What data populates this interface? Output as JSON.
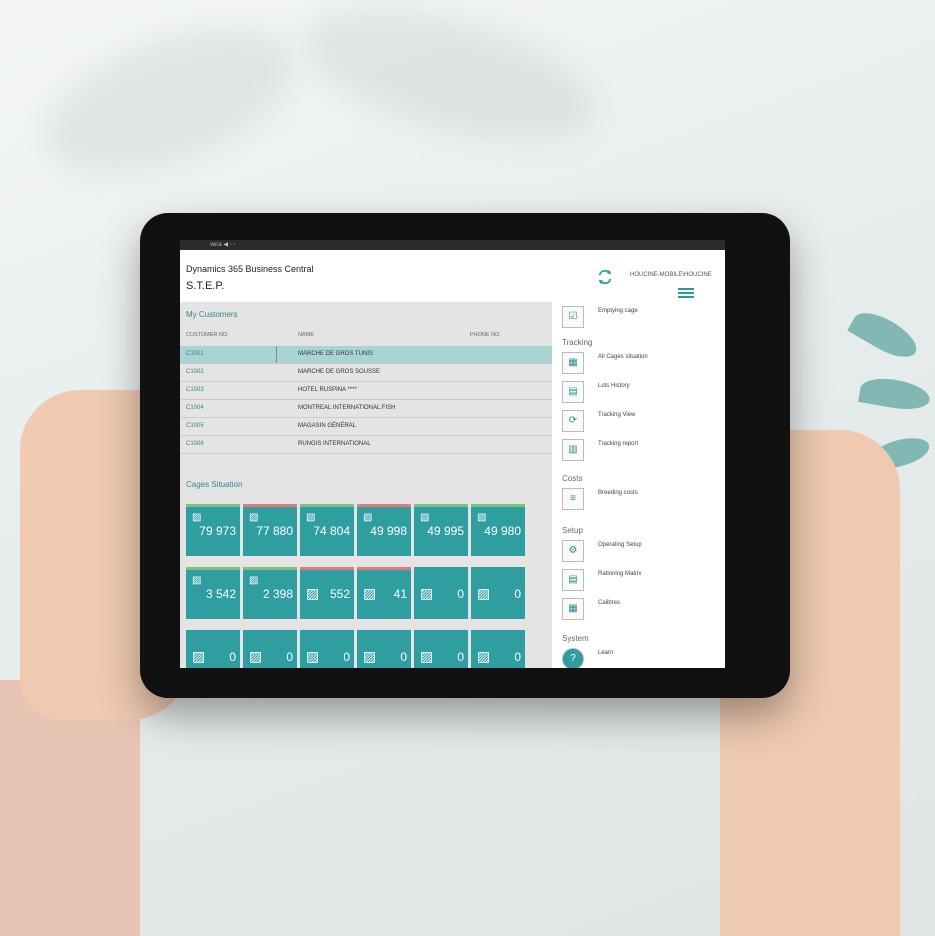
{
  "app": {
    "title": "Dynamics 365 Business Central",
    "company": "S.T.E.P.",
    "user": "HOUCINE-MOBILE\\HOUCINE"
  },
  "customers": {
    "title": "My Customers",
    "columns": [
      "CUSTOMER NO.",
      "NAME",
      "PHONE NO."
    ],
    "rows": [
      {
        "no": "C1001",
        "name": "MARCHE DE GROS TUNIS"
      },
      {
        "no": "C1002",
        "name": "MARCHE DE GROS SOUSSE"
      },
      {
        "no": "C1003",
        "name": "HOTEL RUSPINA ****"
      },
      {
        "no": "C1004",
        "name": "MONTREAL INTERNATIONAL FISH"
      },
      {
        "no": "C1005",
        "name": "MAGASIN GÉNÉRAL"
      },
      {
        "no": "C1006",
        "name": "RUNGIS INTERNATIONAL"
      }
    ]
  },
  "cages": {
    "title": "Cages Situation",
    "row1": [
      "79 973",
      "77 880",
      "74 804",
      "49 998",
      "49 995",
      "49 980"
    ],
    "row2": [
      "3 542",
      "2 398",
      "552",
      "41",
      "0",
      "0"
    ],
    "row3": [
      "0",
      "0",
      "0",
      "0",
      "0",
      "0"
    ],
    "bar_colors": {
      "red": "#e07b7b",
      "green": "#7bc47b"
    }
  },
  "sidebar": {
    "top_item": "Emptying cage",
    "groups": [
      {
        "title": "Tracking",
        "items": [
          "All Cages situation",
          "Lots History",
          "Tracking View",
          "Tracking report"
        ]
      },
      {
        "title": "Costs",
        "items": [
          "Breeding costs"
        ]
      },
      {
        "title": "Setup",
        "items": [
          "Operating Setup",
          "Rationing Matrix",
          "Calibres"
        ]
      },
      {
        "title": "System",
        "items": [
          "Learn"
        ]
      }
    ]
  },
  "colors": {
    "accent": "#2f9ea1",
    "selected_row": "#a9d4d6"
  }
}
